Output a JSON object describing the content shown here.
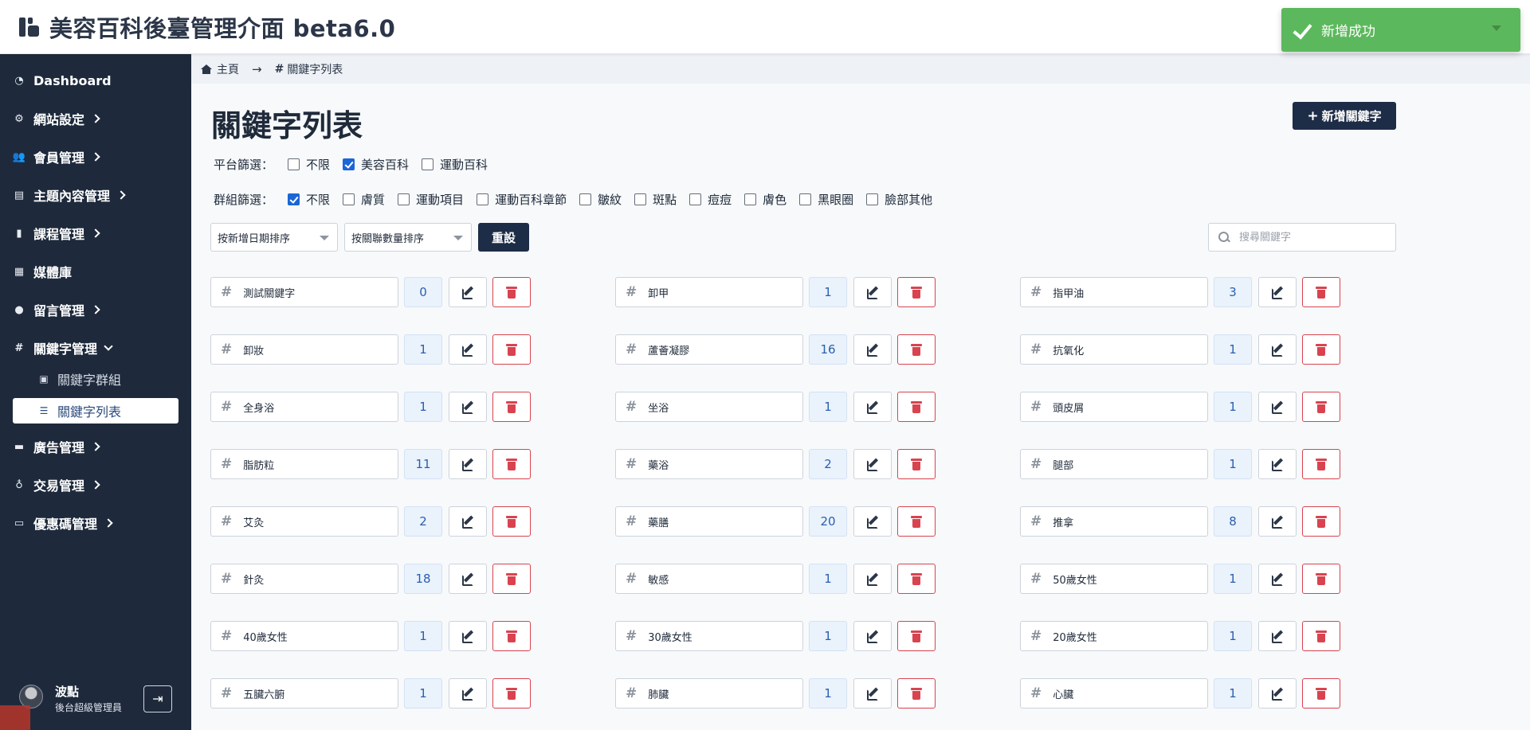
{
  "header": {
    "title": "美容百科後臺管理介面 beta6.0"
  },
  "toast": {
    "message": "新增成功",
    "icon": "check-icon"
  },
  "sidebar": {
    "items": [
      {
        "label": "Dashboard",
        "icon": "dashboard-icon",
        "glyph": "◔",
        "chevron": ""
      },
      {
        "label": "網站設定",
        "icon": "gear-icon",
        "glyph": "⚙",
        "chevron": "right"
      },
      {
        "label": "會員管理",
        "icon": "users-icon",
        "glyph": "👥",
        "chevron": "right"
      },
      {
        "label": "主題內容管理",
        "icon": "newspaper-icon",
        "glyph": "▤",
        "chevron": "right"
      },
      {
        "label": "課程管理",
        "icon": "book-icon",
        "glyph": "▮",
        "chevron": "right"
      },
      {
        "label": "媒體庫",
        "icon": "images-icon",
        "glyph": "▦",
        "chevron": ""
      },
      {
        "label": "留言管理",
        "icon": "comment-icon",
        "glyph": "●",
        "chevron": "right"
      },
      {
        "label": "關鍵字管理",
        "icon": "hashtag-icon",
        "glyph": "#",
        "chevron": "down"
      }
    ],
    "sub_items": [
      {
        "label": "關鍵字群組",
        "icon": "group-icon",
        "glyph": "▣",
        "active": false
      },
      {
        "label": "關鍵字列表",
        "icon": "list-icon",
        "glyph": "☰",
        "active": true
      }
    ],
    "items_after": [
      {
        "label": "廣告管理",
        "icon": "ad-icon",
        "glyph": "▬",
        "chevron": "right"
      },
      {
        "label": "交易管理",
        "icon": "money-bag-icon",
        "glyph": "♁",
        "chevron": "right"
      },
      {
        "label": "優惠碼管理",
        "icon": "ticket-icon",
        "glyph": "▭",
        "chevron": "right"
      }
    ],
    "user": {
      "name": "波點",
      "role": "後台超級管理員"
    }
  },
  "breadcrumb": {
    "home": "主頁",
    "current": "關鍵字列表"
  },
  "page": {
    "title": "關鍵字列表",
    "add_label": "新增關鍵字"
  },
  "filters": {
    "platform": {
      "label": "平台篩選：",
      "options": [
        {
          "label": "不限",
          "checked": false
        },
        {
          "label": "美容百科",
          "checked": true
        },
        {
          "label": "運動百科",
          "checked": false
        }
      ]
    },
    "group": {
      "label": "群組篩選：",
      "options": [
        {
          "label": "不限",
          "checked": true
        },
        {
          "label": "膚質",
          "checked": false
        },
        {
          "label": "運動項目",
          "checked": false
        },
        {
          "label": "運動百科章節",
          "checked": false
        },
        {
          "label": "皺紋",
          "checked": false
        },
        {
          "label": "斑點",
          "checked": false
        },
        {
          "label": "痘痘",
          "checked": false
        },
        {
          "label": "膚色",
          "checked": false
        },
        {
          "label": "黑眼圈",
          "checked": false
        },
        {
          "label": "臉部其他",
          "checked": false
        }
      ]
    }
  },
  "controls": {
    "sort_date": "按新增日期排序",
    "sort_count": "按關聯數量排序",
    "reset_label": "重設",
    "search_placeholder": "搜尋關鍵字"
  },
  "keywords": [
    {
      "name": "測試關鍵字",
      "count": "0"
    },
    {
      "name": "卸甲",
      "count": "1"
    },
    {
      "name": "指甲油",
      "count": "3"
    },
    {
      "name": "卸妝",
      "count": "1"
    },
    {
      "name": "蘆薈凝膠",
      "count": "16"
    },
    {
      "name": "抗氧化",
      "count": "1"
    },
    {
      "name": "全身浴",
      "count": "1"
    },
    {
      "name": "坐浴",
      "count": "1"
    },
    {
      "name": "頭皮屑",
      "count": "1"
    },
    {
      "name": "脂肪粒",
      "count": "11"
    },
    {
      "name": "藥浴",
      "count": "2"
    },
    {
      "name": "腿部",
      "count": "1"
    },
    {
      "name": "艾灸",
      "count": "2"
    },
    {
      "name": "藥膳",
      "count": "20"
    },
    {
      "name": "推拿",
      "count": "8"
    },
    {
      "name": "針灸",
      "count": "18"
    },
    {
      "name": "敏感",
      "count": "1"
    },
    {
      "name": "50歲女性",
      "count": "1"
    },
    {
      "name": "40歲女性",
      "count": "1"
    },
    {
      "name": "30歲女性",
      "count": "1"
    },
    {
      "name": "20歲女性",
      "count": "1"
    },
    {
      "name": "五臟六腑",
      "count": "1"
    },
    {
      "name": "肺臟",
      "count": "1"
    },
    {
      "name": "心臟",
      "count": "1"
    }
  ]
}
